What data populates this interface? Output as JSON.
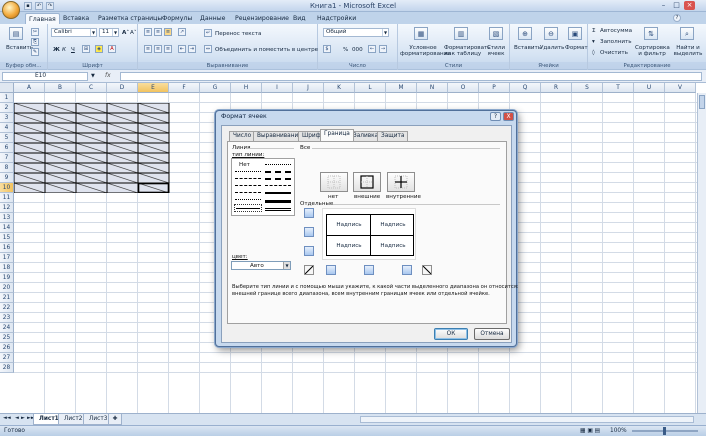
{
  "window": {
    "title": "Книга1 - Microsoft Excel"
  },
  "tabs": [
    "Главная",
    "Вставка",
    "Разметка страницы",
    "Формулы",
    "Данные",
    "Рецензирование",
    "Вид",
    "Надстройки"
  ],
  "ribbon": {
    "clipboard": {
      "paste": "Вставить",
      "label": "Буфер обм..."
    },
    "font": {
      "name": "Calibri",
      "size": "11",
      "bold": "Ж",
      "italic": "К",
      "underline": "Ч",
      "grow": "A˄",
      "shrink": "A˅",
      "label": "Шрифт"
    },
    "alignment": {
      "wrap": "Перенос текста",
      "merge": "Объединить и поместить в центре",
      "label": "Выравнивание"
    },
    "number": {
      "format": "Общий",
      "percent": "%",
      "thousands": "000",
      "label": "Число"
    },
    "styles": {
      "conditional": "Условное форматирование",
      "as_table": "Форматировать как таблицу",
      "cell_styles": "Стили ячеек",
      "label": "Стили"
    },
    "cells": {
      "insert": "Вставить",
      "delete": "Удалить",
      "format": "Формат",
      "label": "Ячейки"
    },
    "editing": {
      "autosum": "Автосумма",
      "fill": "Заполнить",
      "clear": "Очистить",
      "sort": "Сортировка и фильтр",
      "find": "Найти и выделить",
      "label": "Редактирование"
    }
  },
  "formula_bar": {
    "name_box": "E10",
    "fx": "fx",
    "value": ""
  },
  "grid": {
    "columns": [
      "A",
      "B",
      "C",
      "D",
      "E",
      "F",
      "G",
      "H",
      "I",
      "J",
      "K",
      "L",
      "M",
      "N",
      "O",
      "P",
      "Q",
      "R",
      "S",
      "T",
      "U",
      "V"
    ],
    "rows": [
      "1",
      "2",
      "3",
      "4",
      "5",
      "6",
      "7",
      "8",
      "9",
      "10",
      "11",
      "12",
      "13",
      "14",
      "15",
      "16",
      "17",
      "18",
      "19",
      "20",
      "21",
      "22",
      "23",
      "24",
      "25",
      "26",
      "27",
      "28"
    ]
  },
  "sheets": [
    "Лист1",
    "Лист2",
    "Лист3"
  ],
  "status": {
    "ready": "Готово",
    "zoom": "100%"
  },
  "dialog": {
    "title": "Формат ячеек",
    "help": "?",
    "close": "X",
    "tabs": [
      "Число",
      "Выравнивание",
      "Шрифт",
      "Граница",
      "Заливка",
      "Защита"
    ],
    "active_tab": "Граница",
    "line_group": "Линия",
    "line_type_label": "тип линии:",
    "none_line": "Нет",
    "color_label": "цвет:",
    "color_value": "Авто",
    "all_group": "Все",
    "presets": [
      "нет",
      "внешние",
      "внутренние"
    ],
    "separate_group": "Отдельные",
    "preview_text": "Надпись",
    "help_text_1": "Выберите тип линии и с помощью мыши укажите, к какой части выделенного диапазона он относится:",
    "help_text_2": "внешней границе всего диапазона, всем внутренним границам ячеек или отдельной ячейке.",
    "ok": "ОК",
    "cancel": "Отмена"
  }
}
